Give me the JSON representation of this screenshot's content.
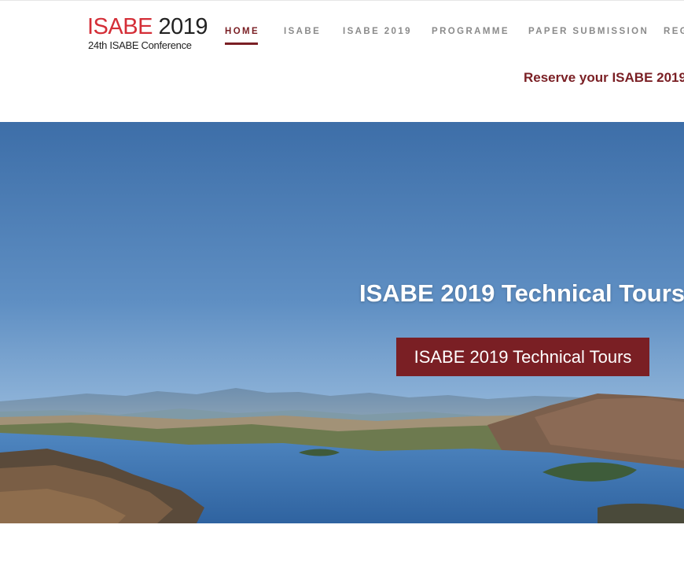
{
  "logo": {
    "brand": "ISABE",
    "year": "2019",
    "subtitle": "24th ISABE Conference"
  },
  "nav": {
    "items": [
      {
        "label": "HOME",
        "active": true
      },
      {
        "label": "ISABE",
        "active": false
      },
      {
        "label": "ISABE 2019",
        "active": false
      },
      {
        "label": "PROGRAMME",
        "active": false
      },
      {
        "label": "PAPER SUBMISSION",
        "active": false
      },
      {
        "label": "REG",
        "active": false
      }
    ]
  },
  "banner": {
    "reserve_text": "Reserve your ISABE 2019"
  },
  "hero": {
    "title": "ISABE 2019 Technical Tours",
    "button_label": "ISABE 2019 Technical Tours"
  },
  "colors": {
    "accent": "#7a1f24",
    "brand_red": "#d42e37",
    "nav_inactive": "#8a8a8a"
  }
}
